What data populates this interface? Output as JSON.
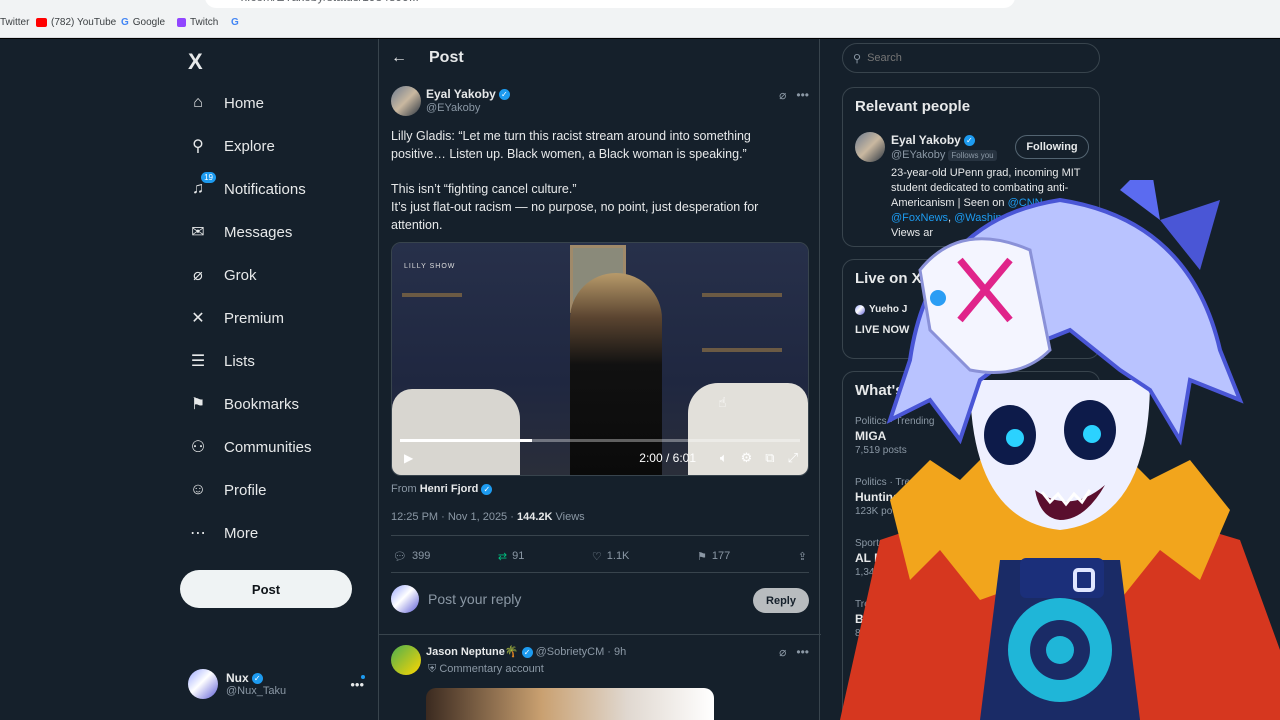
{
  "browser": {
    "url": "x.com/EYakoby/status/1984899...",
    "bookmarks": [
      {
        "label": "Twitter"
      },
      {
        "label": "(782) YouTube"
      },
      {
        "label": "Google"
      },
      {
        "label": "Twitch"
      }
    ]
  },
  "nav": {
    "logo": "X",
    "items": [
      {
        "label": "Home",
        "icon": "home-icon",
        "glyph": "⌂"
      },
      {
        "label": "Explore",
        "icon": "search-icon",
        "glyph": "⚲"
      },
      {
        "label": "Notifications",
        "icon": "bell-icon",
        "glyph": "♫",
        "badge": "19"
      },
      {
        "label": "Messages",
        "icon": "mail-icon",
        "glyph": "✉"
      },
      {
        "label": "Grok",
        "icon": "grok-icon",
        "glyph": "⌀"
      },
      {
        "label": "Premium",
        "icon": "x-icon",
        "glyph": "✕"
      },
      {
        "label": "Lists",
        "icon": "list-icon",
        "glyph": "☰"
      },
      {
        "label": "Bookmarks",
        "icon": "bookmark-icon",
        "glyph": "⚑"
      },
      {
        "label": "Communities",
        "icon": "people-icon",
        "glyph": "⚇"
      },
      {
        "label": "Profile",
        "icon": "person-icon",
        "glyph": "☺"
      },
      {
        "label": "More",
        "icon": "more-icon",
        "glyph": "⋯"
      }
    ],
    "post_label": "Post",
    "me": {
      "name": "Nux",
      "handle": "@Nux_Taku"
    }
  },
  "main": {
    "header_title": "Post",
    "author": {
      "name": "Eyal Yakoby",
      "handle": "@EYakoby"
    },
    "text": [
      "Lilly Gladis: “Let me turn this racist stream around into something positive… Listen up. Black women, a Black woman is speaking.”",
      "This isn’t “fighting cancel culture.”",
      "It’s just flat-out racism — no purpose, no point, just desperation for attention."
    ],
    "video": {
      "watermark": "LILLY SHOW",
      "time": "2:00 / 6:01",
      "progress": 0.33
    },
    "from_label": "From",
    "from_name": "Henri Fjord",
    "timestamp": "12:25 PM · Nov 1, 2025 ·",
    "views_count": "144.2K",
    "views_label": "Views",
    "actions": {
      "replies": "399",
      "reposts": "91",
      "likes": "1.1K",
      "bookmarks": "177"
    },
    "reply_placeholder": "Post your reply",
    "reply_button": "Reply",
    "reply2": {
      "name": "Jason Neptune🌴",
      "handle": "@SobrietyCM · 9h",
      "sub": "Commentary account"
    }
  },
  "right": {
    "search_placeholder": "Search",
    "relevant": {
      "title": "Relevant people",
      "name": "Eyal Yakoby",
      "handle": "@EYakoby",
      "follows_you": "Follows you",
      "button": "Following",
      "bio_1": "23-year-old UPenn grad, incoming MIT student dedicated to combating anti-Americanism | Seen on",
      "bio_link_1": "@CNN",
      "bio_link_2": "@FoxNews",
      "bio_link_3": "@WashingtonP",
      "bio_more": "more | Views ar"
    },
    "live": {
      "title": "Live on X",
      "host": "Yueho J",
      "status": "LIVE NOW"
    },
    "trends": {
      "title": "What's h",
      "items": [
        {
          "category": "Politics · Trending",
          "title": "MIGA",
          "count": "7,519 posts"
        },
        {
          "category": "Politics · Trendi",
          "title": "Huntingt",
          "count": "123K po"
        },
        {
          "category": "Sports · Tr",
          "title": "AL Eas",
          "count": "1,342 pos"
        },
        {
          "category": "Trendi",
          "title": "Bib",
          "count": "8,"
        }
      ]
    }
  },
  "colors": {
    "background": "#15202b",
    "accent": "#1d9bf0",
    "border": "#38444d"
  }
}
